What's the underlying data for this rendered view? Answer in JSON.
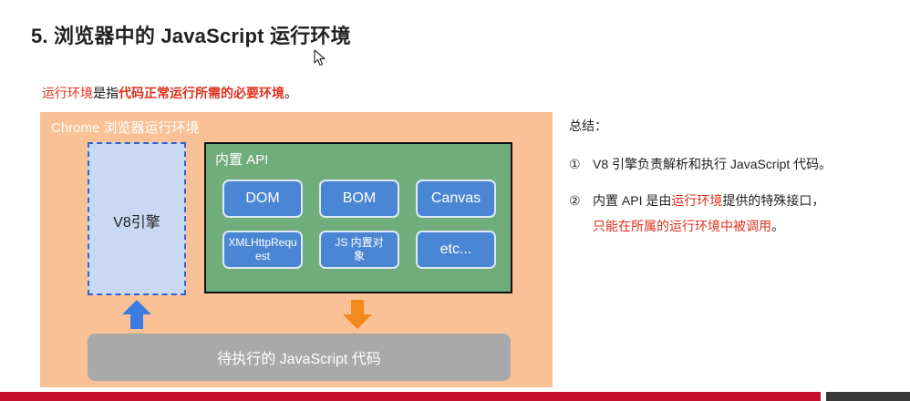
{
  "slide": {
    "title": "5. 浏览器中的 JavaScript 运行环境"
  },
  "definition": {
    "part1": "运行环境",
    "part2": "是指",
    "part3": "代码正常运行所需的必要环境",
    "part4": "。"
  },
  "diagram": {
    "env_title": "Chrome 浏览器运行环境",
    "engine_label": "V8引擎",
    "api_title": "内置 API",
    "api_items": [
      "DOM",
      "BOM",
      "Canvas",
      "XMLHttpRequest",
      "JS 内置对象",
      "etc..."
    ],
    "code_label": "待执行的 JavaScript 代码",
    "colors": {
      "env_bg": "#f9c195",
      "engine_bg": "#c9d8f3",
      "api_bg": "#6fad7b",
      "api_button": "#4a86d4",
      "arrow_up": "#3c7be0",
      "arrow_down": "#f28a1d",
      "code_bar": "#a9a9a9"
    }
  },
  "summary": {
    "title": "总结：",
    "item1_num": "①",
    "item1_text": "V8 引擎负责解析和执行 JavaScript 代码。",
    "item2_num": "②",
    "item2_a": "内置 API 是由",
    "item2_b": "运行环境",
    "item2_c": "提供的特殊接口，",
    "item2_d": "只能在所属的运行环境中被调用",
    "item2_e": "。"
  }
}
